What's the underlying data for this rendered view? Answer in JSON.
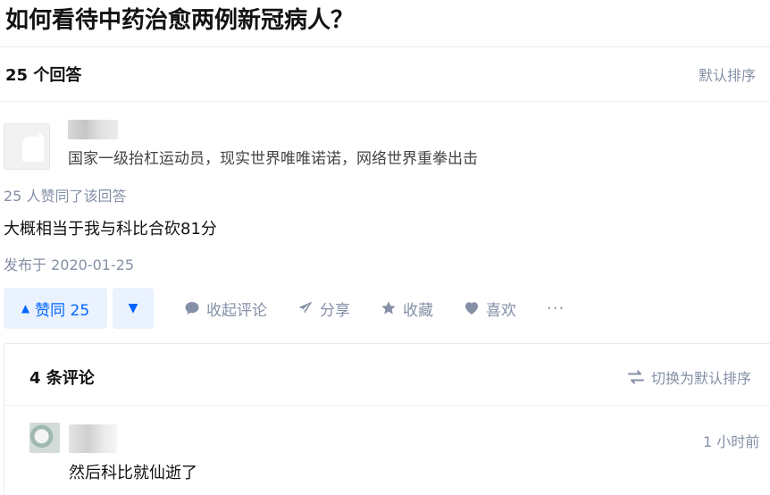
{
  "question": {
    "title": "如何看待中药治愈两例新冠病人？"
  },
  "answers_header": {
    "count_label": "25 个回答",
    "sort_label": "默认排序"
  },
  "answer": {
    "author": {
      "name": "",
      "headline": "国家一级抬杠运动员，现实世界唯唯诺诺，网络世界重拳出击"
    },
    "vote_summary": "25 人赞同了该回答",
    "content": "大概相当于我与科比合砍81分",
    "publish_time": "发布于 2020-01-25",
    "actions": {
      "upvote_label": "赞同 25",
      "upvote_icon": "triangle-up-icon",
      "downvote_icon": "triangle-down-icon",
      "collapse_comments": "收起评论",
      "share": "分享",
      "favorite": "收藏",
      "like": "喜欢",
      "more": "···"
    }
  },
  "comments": {
    "count_label": "4 条评论",
    "sort_toggle": "切换为默认排序",
    "items": [
      {
        "author": "",
        "time": "1 小时前",
        "text": "然后科比就仙逝了"
      }
    ]
  },
  "colors": {
    "accent": "#0066ff",
    "muted": "#8590a6",
    "vote_bg": "#eaf2fd"
  }
}
